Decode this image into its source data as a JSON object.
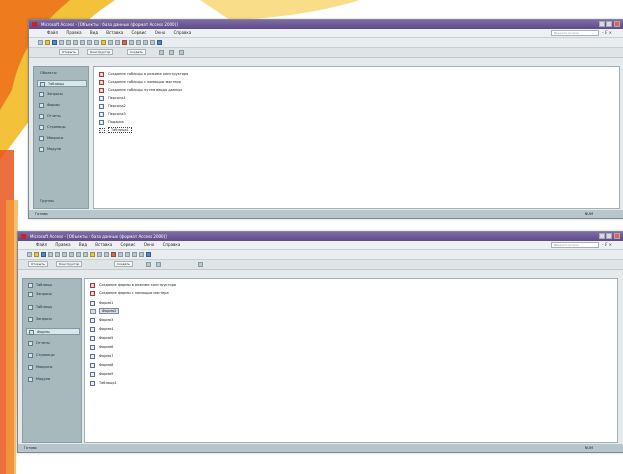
{
  "window1": {
    "title": "Microsoft Access - [Объекты : база данных (формат Access 2000)]",
    "menu": [
      "Файл",
      "Правка",
      "Вид",
      "Вставка",
      "Сервис",
      "Окно",
      "Справка"
    ],
    "help_placeholder": "Введите вопрос",
    "window_controls": "- ₣ ×",
    "db_toolbar": {
      "open": "Открыть",
      "design": "Конструктор",
      "create": "Создать"
    },
    "sidebar": {
      "header": "Объекты",
      "items": [
        {
          "label": "Таблицы",
          "icon": "table-icon",
          "selected": true
        },
        {
          "label": "Запросы",
          "icon": "query-icon",
          "selected": false
        },
        {
          "label": "Формы",
          "icon": "form-icon",
          "selected": false
        },
        {
          "label": "Отчеты",
          "icon": "report-icon",
          "selected": false
        },
        {
          "label": "Страницы",
          "icon": "page-icon",
          "selected": false
        },
        {
          "label": "Макросы",
          "icon": "macro-icon",
          "selected": false
        },
        {
          "label": "Модули",
          "icon": "module-icon",
          "selected": false
        }
      ],
      "footer": "Группы"
    },
    "list": [
      {
        "label": "Создание таблицы в режиме конструктора",
        "icon": "wizard-icon"
      },
      {
        "label": "Создание таблицы с помощью мастера",
        "icon": "wizard-icon"
      },
      {
        "label": "Создание таблицы путем ввода данных",
        "icon": "wizard-icon"
      },
      {
        "label": "Персона1",
        "icon": "table-icon"
      },
      {
        "label": "Персона2",
        "icon": "table-icon"
      },
      {
        "label": "Персона3",
        "icon": "table-icon"
      },
      {
        "label": "Подарок",
        "icon": "table-icon"
      },
      {
        "label": "Таблица1",
        "icon": "table-icon"
      }
    ],
    "status_left": "Готово",
    "status_right": "NUM"
  },
  "window2": {
    "title": "Microsoft Access - [Объекты : база данных (формат Access 2000)]",
    "menu": [
      "Файл",
      "Правка",
      "Вид",
      "Вставка",
      "Сервис",
      "Окно",
      "Справка"
    ],
    "help_placeholder": "Введите вопрос",
    "window_controls": "- ₣ ×",
    "db_toolbar": {
      "open": "Открыть",
      "design": "Конструктор",
      "create": "Создать"
    },
    "sidebar": {
      "items": [
        {
          "label": "Таблицы",
          "icon": "table-icon",
          "selected": false
        },
        {
          "label": "Запросы",
          "icon": "query-icon",
          "selected": false
        },
        {
          "label": "Таблицы",
          "icon": "table-icon",
          "selected": false
        },
        {
          "label": "Запросы",
          "icon": "query-icon",
          "selected": false
        },
        {
          "label": "Формы",
          "icon": "form-icon",
          "selected": true
        },
        {
          "label": "Отчеты",
          "icon": "report-icon",
          "selected": false
        },
        {
          "label": "Страницы",
          "icon": "page-icon",
          "selected": false
        },
        {
          "label": "Макросы",
          "icon": "macro-icon",
          "selected": false
        },
        {
          "label": "Модули",
          "icon": "module-icon",
          "selected": false
        }
      ]
    },
    "list": [
      {
        "label": "Создание формы в режиме конструктора",
        "icon": "wizard-icon"
      },
      {
        "label": "Создание формы с помощью мастера",
        "icon": "wizard-icon"
      },
      {
        "label": "Форма1",
        "icon": "form-icon"
      },
      {
        "label": "Форма2",
        "icon": "form-icon"
      },
      {
        "label": "Форма3",
        "icon": "form-icon"
      },
      {
        "label": "Форма4",
        "icon": "form-icon"
      },
      {
        "label": "Форма5",
        "icon": "form-icon"
      },
      {
        "label": "Форма6",
        "icon": "form-icon"
      },
      {
        "label": "Форма7",
        "icon": "form-icon"
      },
      {
        "label": "Форма8",
        "icon": "form-icon"
      },
      {
        "label": "Форма9",
        "icon": "form-icon"
      },
      {
        "label": "Таблица1",
        "icon": "form-icon"
      }
    ],
    "status_left": "Готово",
    "status_right": "NUM"
  },
  "colors": {
    "title_bar": "#6b5897",
    "sidebar": "#a7b9bd",
    "status_bar": "#b6c6cb"
  }
}
